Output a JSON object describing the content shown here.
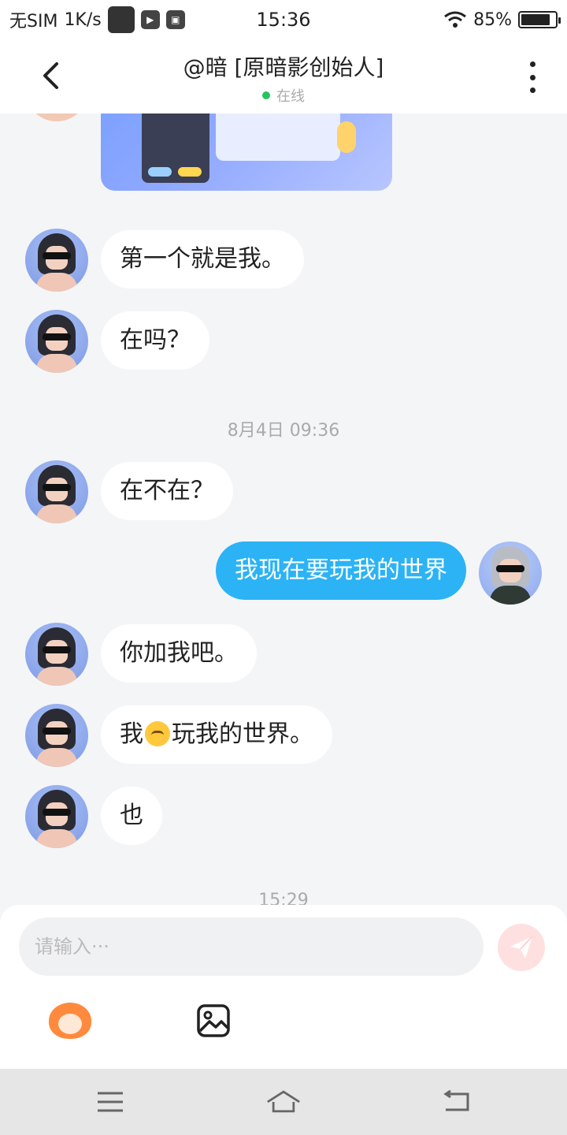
{
  "status_bar": {
    "carrier": "无SIM",
    "speed": "1K/s",
    "time": "15:36",
    "battery_text": "85%",
    "battery_level_percent": 85
  },
  "header": {
    "title": "@暗 [原暗影创始人]",
    "status": "在线",
    "status_color": "#22c55e"
  },
  "messages": [
    {
      "side": "left",
      "text": "第一个就是我。"
    },
    {
      "side": "left",
      "text": "在吗？"
    },
    {
      "side": "left",
      "text": "在不在？"
    },
    {
      "side": "right",
      "text": "我现在要玩我的世界"
    },
    {
      "side": "left",
      "text": "你加我吧。"
    },
    {
      "side": "left",
      "text_before": "我",
      "emoji": "disappointed-face",
      "text_after": "玩我的世界。"
    },
    {
      "side": "left",
      "text": "也"
    }
  ],
  "timestamps": [
    "8月4日 09:36",
    "15:29"
  ],
  "composer": {
    "placeholder": "请输入···",
    "send_color": "#ffe0e0"
  },
  "colors": {
    "outgoing_bubble": "#2bb3f5",
    "incoming_bubble": "#ffffff",
    "background": "#f4f5f7"
  }
}
